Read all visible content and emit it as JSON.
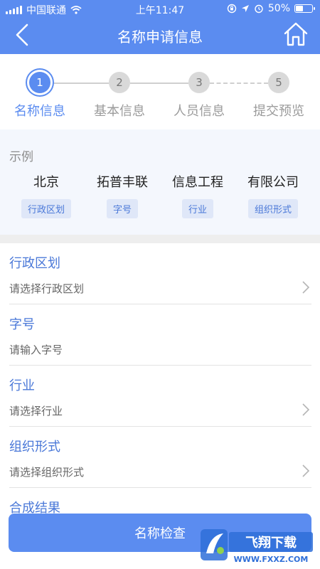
{
  "status_bar": {
    "carrier": "中国联通",
    "time": "上午11:47",
    "battery": "50%"
  },
  "nav": {
    "title": "名称申请信息"
  },
  "stepper": {
    "steps": [
      {
        "number": "1",
        "label": "名称信息",
        "active": true
      },
      {
        "number": "2",
        "label": "基本信息",
        "active": false
      },
      {
        "number": "3",
        "label": "人员信息",
        "active": false
      },
      {
        "number": "5",
        "label": "提交预览",
        "active": false
      }
    ]
  },
  "example": {
    "title": "示例",
    "columns": [
      {
        "word": "北京",
        "tag": "行政区划"
      },
      {
        "word": "拓普丰联",
        "tag": "字号"
      },
      {
        "word": "信息工程",
        "tag": "行业"
      },
      {
        "word": "有限公司",
        "tag": "组织形式"
      }
    ]
  },
  "form": {
    "region": {
      "label": "行政区划",
      "placeholder": "请选择行政区划"
    },
    "brand": {
      "label": "字号",
      "placeholder": "请输入字号"
    },
    "industry": {
      "label": "行业",
      "placeholder": "请选择行业"
    },
    "org_form": {
      "label": "组织形式",
      "placeholder": "请选择组织形式"
    },
    "result": {
      "label": "合成结果"
    }
  },
  "actions": {
    "check_label": "名称检查"
  },
  "watermark": {
    "brand": "飞翔下载",
    "url": "WWW.FXXZ.COM"
  },
  "colors": {
    "primary": "#5b8cf0",
    "label_blue": "#4a78d8",
    "example_bg": "#f4f7fd"
  }
}
